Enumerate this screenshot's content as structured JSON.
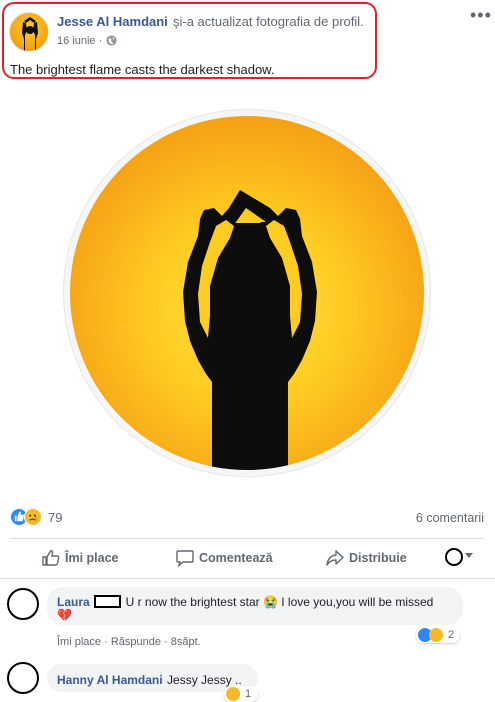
{
  "post": {
    "author": "Jesse Al Hamdani",
    "action": "şi-a actualizat fotografia de profil.",
    "date": "16 iunie",
    "date_separator": "·",
    "caption": "The brightest flame casts the darkest shadow.",
    "more_menu": "•••"
  },
  "reactions": {
    "count": "79",
    "icons": [
      "like-icon",
      "sad-icon"
    ],
    "comments_count": "6 comentarii"
  },
  "actions": {
    "like_label": "Îmi place",
    "comment_label": "Comentează",
    "share_label": "Distribuie"
  },
  "comments": [
    {
      "author": "Laura",
      "text": "U r now the brightest star 😭 I love you,you will be missed",
      "text_line2": "💔",
      "like": "Îmi place",
      "reply": "Răspunde",
      "time": "8săpt.",
      "reaction_count": "2"
    },
    {
      "author": "Hanny Al Hamdani",
      "text": "Jessy Jessy ..",
      "reaction_count": "1"
    }
  ],
  "colors": {
    "name_blue": "#385898",
    "annotation_red": "#e0232b",
    "like_blue": "#2d88ff",
    "sad_yellow": "#f7b928"
  }
}
